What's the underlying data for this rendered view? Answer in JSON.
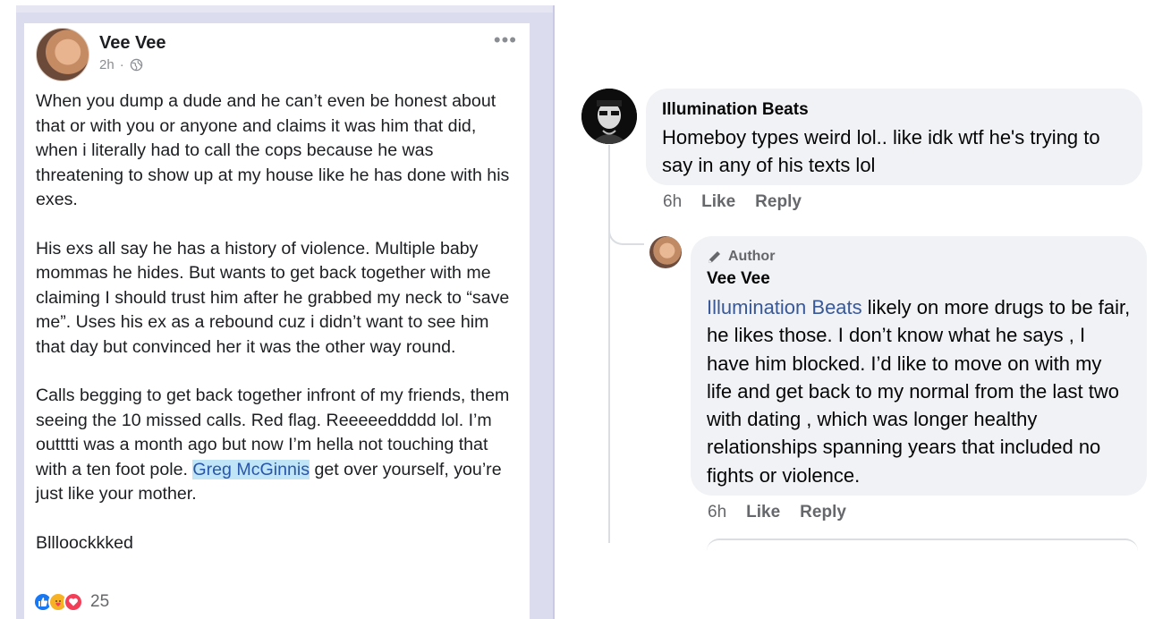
{
  "post": {
    "author": "Vee Vee",
    "time": "2h",
    "separator": "·",
    "more_label": "•••",
    "paragraphs": [
      "When you dump a dude and he can’t even be honest about that or  with you or anyone and claims it was him that did, when i literally had to call the cops because he was threatening to show up at my house like he has done with his exes.",
      "His exs all say he has a history of violence. Multiple baby mommas he hides. But wants to get back together with me claiming I should trust him after he grabbed my neck to “save me”. Uses his ex as a rebound cuz i didn’t want to see him that day but convinced her it was the other way round."
    ],
    "para3_before": "Calls begging to get back together infront of my friends, them seeing the 10 missed calls. Red flag. Reeeeeddddd lol. I’m outttti was a month ago but now I’m hella not touching that with a ten foot pole. ",
    "para3_mention": "Greg McGinnis",
    "para3_after": " get over yourself, you’re just like your mother.",
    "closing": "Bllloockkked",
    "reaction_count": "25",
    "icons": [
      "globe-icon",
      "more-icon",
      "like-icon",
      "care-icon",
      "love-icon"
    ]
  },
  "comments": [
    {
      "author": "Illumination Beats",
      "text": "Homeboy types weird lol.. like idk wtf he's trying to say in any of his texts lol",
      "time": "6h",
      "like_label": "Like",
      "reply_label": "Reply"
    },
    {
      "badge": "Author",
      "author": "Vee Vee",
      "mention": "Illumination Beats",
      "text": " likely on more drugs to be fair, he likes those. I don’t know what he says , I have him blocked. I’d like to move on with my life and get back to my normal from the last two with dating , which was longer healthy relationships spanning years that included no fights or violence.",
      "time": "6h",
      "like_label": "Like",
      "reply_label": "Reply"
    }
  ],
  "colors": {
    "bubble_bg": "#f0f2f5",
    "mention_link": "#385898",
    "mention_highlight": "#bfe5f7",
    "frame_bg": "#dcdcef",
    "meta_gray": "#65676b"
  }
}
